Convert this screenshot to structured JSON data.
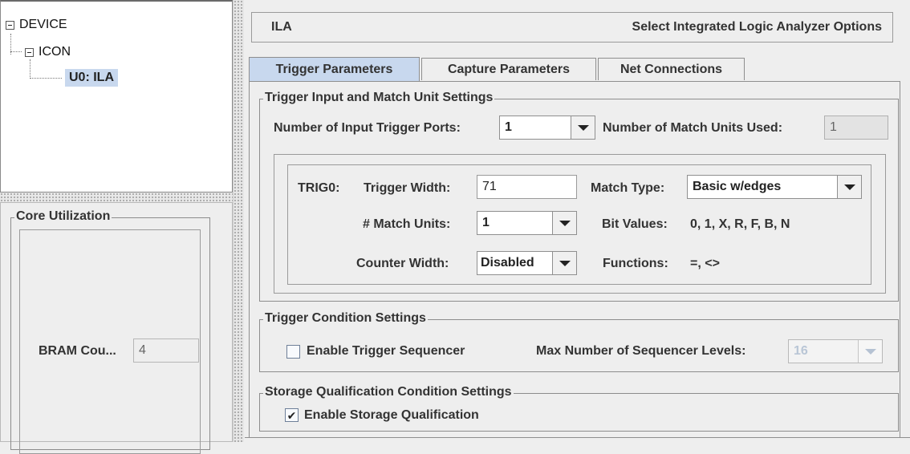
{
  "tree": {
    "root": "DEVICE",
    "child": "ICON",
    "leaf": "U0: ILA"
  },
  "core_utilization": {
    "title": "Core Utilization",
    "bram_label": "BRAM Cou...",
    "bram_value": "4"
  },
  "header": {
    "core_name": "ILA",
    "description": "Select Integrated Logic Analyzer Options"
  },
  "tabs": [
    {
      "label": "Trigger Parameters",
      "active": true
    },
    {
      "label": "Capture Parameters",
      "active": false
    },
    {
      "label": "Net Connections",
      "active": false
    }
  ],
  "trigger_input": {
    "title": "Trigger Input and Match Unit Settings",
    "num_ports_label": "Number of Input Trigger Ports:",
    "num_ports_value": "1",
    "match_units_used_label": "Number of Match Units Used:",
    "match_units_used_value": "1",
    "trig0": {
      "name_label": "TRIG0:",
      "width_label": "Trigger Width:",
      "width_value": "71",
      "match_type_label": "Match Type:",
      "match_type_value": "Basic w/edges",
      "match_units_label": "# Match Units:",
      "match_units_value": "1",
      "bit_values_label": "Bit Values:",
      "bit_values": "0, 1, X, R, F, B, N",
      "counter_width_label": "Counter Width:",
      "counter_width_value": "Disabled",
      "functions_label": "Functions:",
      "functions": "=, <>"
    }
  },
  "trigger_condition": {
    "title": "Trigger Condition Settings",
    "enable_sequencer_label": "Enable Trigger Sequencer",
    "enable_sequencer_checked": false,
    "max_levels_label": "Max Number of Sequencer Levels:",
    "max_levels_value": "16"
  },
  "storage_qualification": {
    "title": "Storage Qualification Condition Settings",
    "enable_label": "Enable Storage Qualification",
    "enable_checked": true,
    "check_glyph": "✔"
  },
  "colors": {
    "selection": "#c8d8ee",
    "panel_bg": "#eeeeee",
    "disabled_text": "#b9c6d6"
  }
}
